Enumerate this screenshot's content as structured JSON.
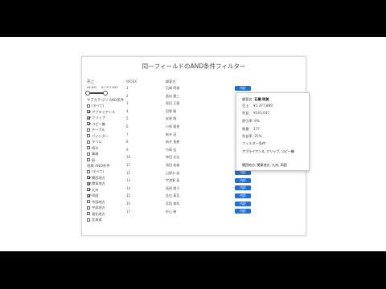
{
  "title": "同一フィールドのAND条件フィルター",
  "range": {
    "label": "売上",
    "min": "¥6,830",
    "max": "¥1,377,899",
    "fill_fraction": 1.0
  },
  "subcategory": {
    "label": "サブカテゴリ AND条件",
    "items": [
      {
        "label": "(すべて)",
        "checked": false
      },
      {
        "label": "アプライアンス",
        "checked": true
      },
      {
        "label": "クリップ",
        "checked": true
      },
      {
        "label": "コピー機",
        "checked": true
      },
      {
        "label": "テーブル",
        "checked": false
      },
      {
        "label": "バインダー",
        "checked": false
      },
      {
        "label": "ラベル",
        "checked": false
      },
      {
        "label": "椅子",
        "checked": false
      },
      {
        "label": "事務",
        "checked": false
      },
      {
        "label": "紙",
        "checked": false
      }
    ]
  },
  "region": {
    "label": "地域 AND条件",
    "items": [
      {
        "label": "(すべて)",
        "checked": false
      },
      {
        "label": "関西地方",
        "checked": true
      },
      {
        "label": "関東地方",
        "checked": true
      },
      {
        "label": "九州",
        "checked": true
      },
      {
        "label": "四国",
        "checked": true
      },
      {
        "label": "中国地方",
        "checked": false
      },
      {
        "label": "中部地方",
        "checked": false
      },
      {
        "label": "東北地方",
        "checked": false
      },
      {
        "label": "北海道",
        "checked": false
      }
    ]
  },
  "table": {
    "index_header": "INDEX",
    "name_header": "顧客名",
    "rows": [
      {
        "index": "1",
        "name": "石橋 明美",
        "badge": "内訳"
      },
      {
        "index": "2",
        "name": "畠松 健三",
        "badge": ""
      },
      {
        "index": "3",
        "name": "堀田 正憲",
        "badge": ""
      },
      {
        "index": "4",
        "name": "田野 勝",
        "badge": ""
      },
      {
        "index": "5",
        "name": "安尾 剛",
        "badge": ""
      },
      {
        "index": "6",
        "name": "小原 優香",
        "badge": ""
      },
      {
        "index": "7",
        "name": "新井 茂",
        "badge": ""
      },
      {
        "index": "8",
        "name": "新井 直樹",
        "badge": ""
      },
      {
        "index": "9",
        "name": "竹崎 浩",
        "badge": ""
      },
      {
        "index": "10",
        "name": "神田 光夫",
        "badge": ""
      },
      {
        "index": "11",
        "name": "清田 祐美",
        "badge": ""
      },
      {
        "index": "12",
        "name": "山野木 滋",
        "badge": "内訳"
      },
      {
        "index": "13",
        "name": "宇津野 泰",
        "badge": "内訳"
      },
      {
        "index": "14",
        "name": "高岡 陽子",
        "badge": "内訳"
      },
      {
        "index": "15",
        "name": "金広 真吾",
        "badge": "内訳"
      },
      {
        "index": "16",
        "name": "宮園 美和",
        "badge": "内訳"
      },
      {
        "index": "17",
        "name": "折山 樹",
        "badge": "内訳"
      }
    ]
  },
  "tooltip": {
    "customer_label": "顧客名:",
    "customer_value": "石橋 明美",
    "sales": "売上:　¥1,377,899",
    "profit": "利益:　¥143,047",
    "discount": "割引率:  8%",
    "quantity": "数量:　177",
    "profit_rate": "利益率:  25%",
    "filter_label": "フィルター条件:",
    "filter_subcategory": "アプライアンス, クリップ, コピー機",
    "filter_region": "関西地方, 関東地方, 九州, 四国"
  },
  "colors": {
    "accent": "#1e6fd9",
    "background": "#ffffff",
    "frame": "#000000"
  }
}
